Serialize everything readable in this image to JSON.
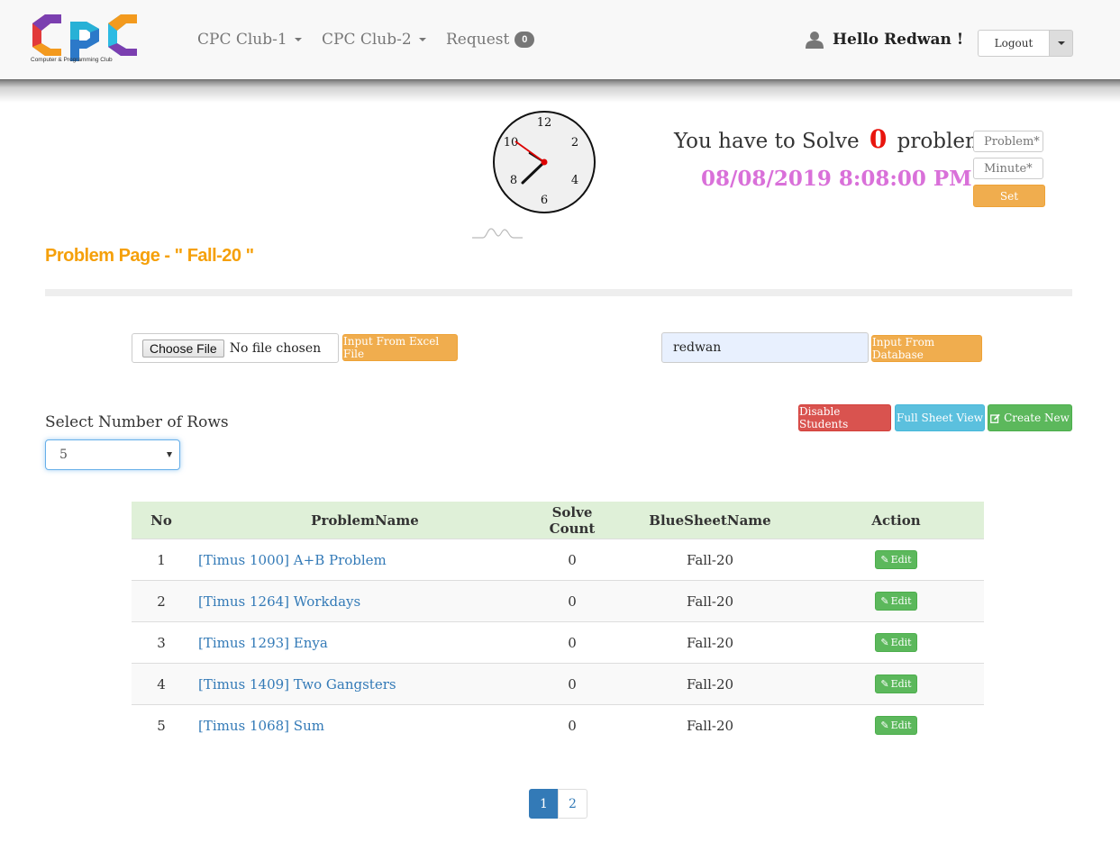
{
  "navbar": {
    "logo_subtitle": "Computer & Programming Club",
    "menu": [
      {
        "label": "CPC Club-1"
      },
      {
        "label": "CPC Club-2"
      },
      {
        "label": "Request",
        "badge": "0"
      }
    ],
    "greeting": "Hello Redwan !",
    "logout_label": "Logout"
  },
  "clock": {
    "numbers": [
      "12",
      "2",
      "4",
      "6",
      "8",
      "10"
    ]
  },
  "goal": {
    "prefix": "You have to Solve",
    "count": "0",
    "suffix": "problems",
    "datetime": "08/08/2019 8:08:00 PM",
    "problem_placeholder": "Problem*",
    "minute_placeholder": "Minute*",
    "set_label": "Set"
  },
  "page": {
    "title": "Problem Page - \" Fall-20 \""
  },
  "import": {
    "choose_file_label": "Choose File",
    "file_status": "No file chosen",
    "excel_button": "Input From Excel File",
    "db_value": "redwan",
    "db_button": "Input From Database"
  },
  "rows": {
    "label": "Select Number of Rows",
    "selected": "5"
  },
  "actions": {
    "disable": "Disable Students",
    "full_sheet": "Full Sheet View",
    "create_new": "Create New"
  },
  "table": {
    "headers": [
      "No",
      "ProblemName",
      "Solve Count",
      "BlueSheetName",
      "Action"
    ],
    "rows": [
      {
        "no": "1",
        "name": "[Timus 1000] A+B Problem",
        "solve": "0",
        "sheet": "Fall-20",
        "action": "Edit"
      },
      {
        "no": "2",
        "name": "[Timus 1264] Workdays",
        "solve": "0",
        "sheet": "Fall-20",
        "action": "Edit"
      },
      {
        "no": "3",
        "name": "[Timus 1293] Enya",
        "solve": "0",
        "sheet": "Fall-20",
        "action": "Edit"
      },
      {
        "no": "4",
        "name": "[Timus 1409] Two Gangsters",
        "solve": "0",
        "sheet": "Fall-20",
        "action": "Edit"
      },
      {
        "no": "5",
        "name": "[Timus 1068] Sum",
        "solve": "0",
        "sheet": "Fall-20",
        "action": "Edit"
      }
    ]
  },
  "pagination": {
    "pages": [
      "1",
      "2"
    ],
    "active": "1"
  },
  "colors": {
    "accent_orange": "#f0ad4e",
    "title_orange": "#f5a00a",
    "datetime_pink": "#d970d9",
    "count_red": "#e8150e",
    "link_blue": "#337ab7"
  },
  "icons": [
    "user-icon",
    "caret-down-icon",
    "pencil-edit-icon",
    "edit-square-icon"
  ]
}
